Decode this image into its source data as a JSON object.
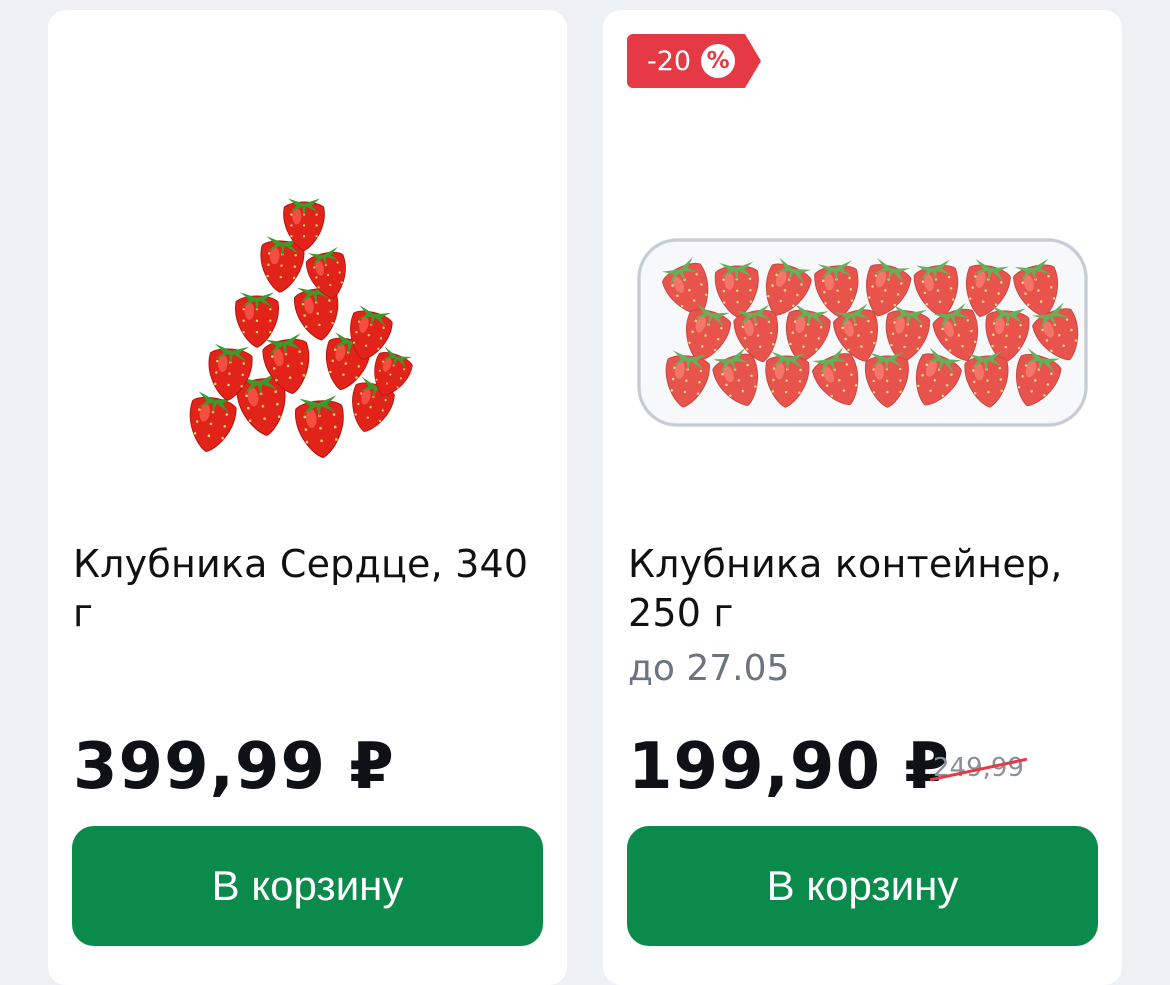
{
  "products": [
    {
      "title": "Клубника Сердце, 340 г",
      "price": "399,99 ₽",
      "button_label": "В корзину",
      "image": "strawberry-pile-image"
    },
    {
      "badge_text": "-20",
      "badge_symbol": "%",
      "title": "Клубника контейнер, 250 г",
      "validity": "до 27.05",
      "price": "199,90 ₽",
      "old_price": "249,99",
      "button_label": "В корзину",
      "image": "strawberry-container-image"
    }
  ],
  "colors": {
    "accent_green": "#0a8a4b",
    "discount_red": "#e63946",
    "background": "#eef1f4"
  }
}
